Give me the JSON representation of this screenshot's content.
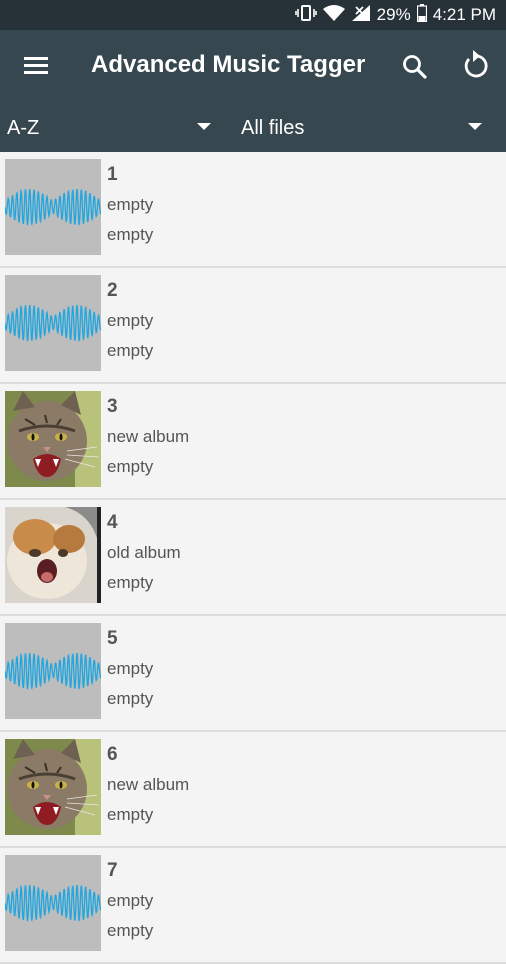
{
  "status": {
    "battery": "29%",
    "time": "4:21 PM"
  },
  "appbar": {
    "title": "Advanced Music Tagger"
  },
  "filters": {
    "sort": "A-Z",
    "scope": "All files"
  },
  "tracks": [
    {
      "title": "1",
      "album": "empty",
      "artist": "empty",
      "art": "waveform"
    },
    {
      "title": "2",
      "album": "empty",
      "artist": "empty",
      "art": "waveform"
    },
    {
      "title": "3",
      "album": "new album",
      "artist": "empty",
      "art": "angry-cat"
    },
    {
      "title": "4",
      "album": "old album",
      "artist": "empty",
      "art": "screaming-cat"
    },
    {
      "title": "5",
      "album": "empty",
      "artist": "empty",
      "art": "waveform"
    },
    {
      "title": "6",
      "album": "new album",
      "artist": "empty",
      "art": "angry-cat"
    },
    {
      "title": "7",
      "album": "empty",
      "artist": "empty",
      "art": "waveform"
    }
  ],
  "colors": {
    "statusbar": "#263238",
    "toolbar": "#37474f",
    "waveform": "#1ea7e1",
    "placeholder": "#bdbdbd"
  }
}
